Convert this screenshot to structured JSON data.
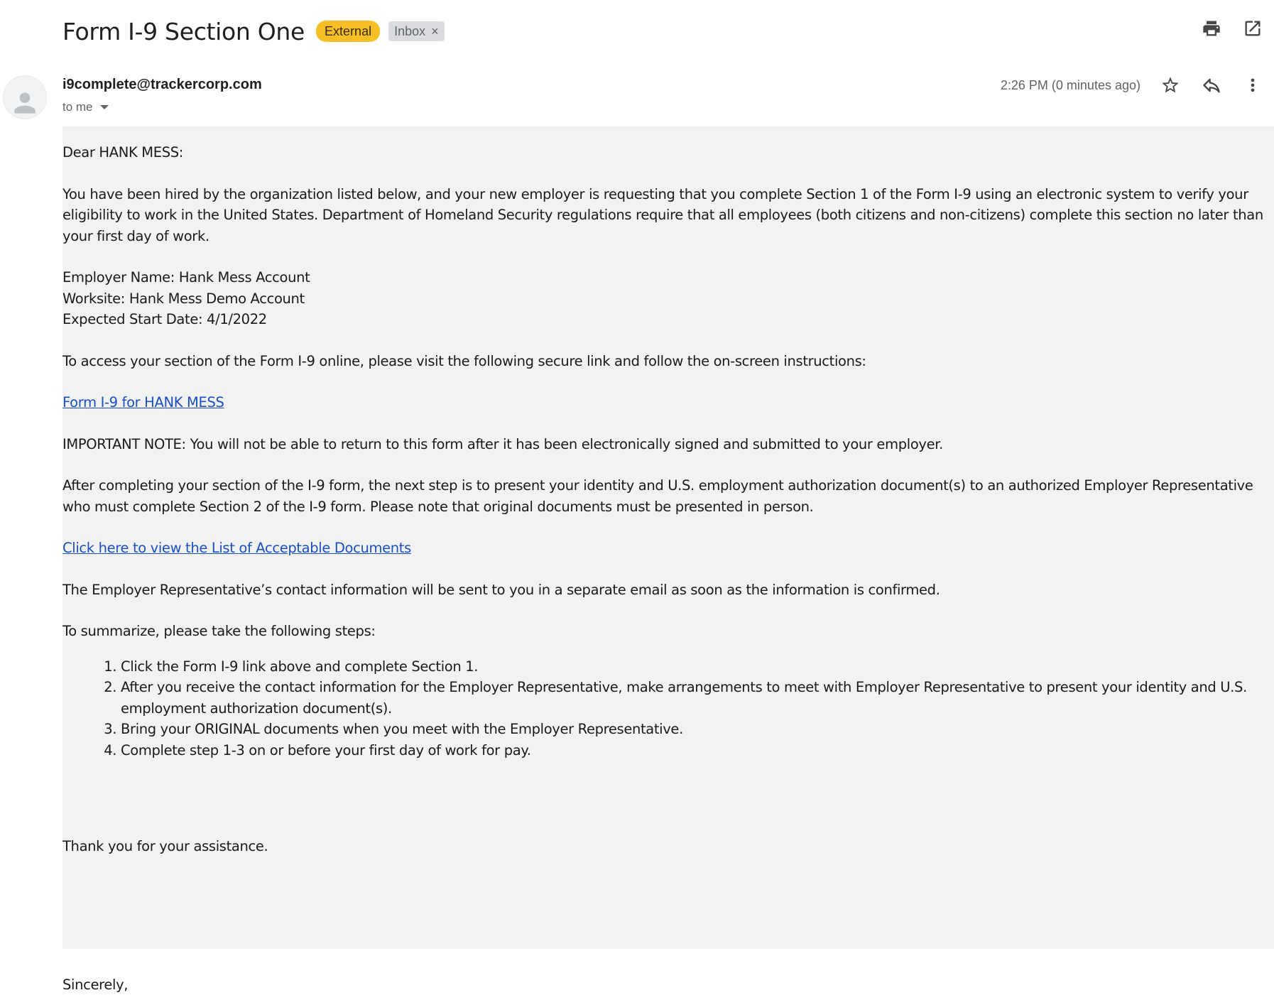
{
  "header": {
    "subject": "Form I-9 Section One",
    "label_external": "External",
    "label_inbox": "Inbox",
    "label_remove": "×"
  },
  "message": {
    "sender": "i9complete@trackercorp.com",
    "recipient": "to me",
    "timestamp": "2:26 PM (0 minutes ago)"
  },
  "body": {
    "greeting": "Dear HANK MESS:",
    "intro": "You have been hired by the organization listed below, and your new employer is requesting that you complete Section 1 of the Form I-9 using an electronic system to verify your eligibility to work in the United States. Department of Homeland Security regulations require that all employees (both citizens and non-citizens) complete this section no later than your first day of work.",
    "employer_name": "Employer Name: Hank Mess Account",
    "worksite": "Worksite: Hank Mess Demo Account",
    "start_date": "Expected Start Date: 4/1/2022",
    "access_text": "To access your section of the Form I-9 online, please visit the following secure link and follow the on-screen instructions:",
    "form_link": "Form I-9 for HANK MESS",
    "important_note": "IMPORTANT NOTE: You will not be able to return to this form after it has been electronically signed and submitted to your employer.",
    "after_completing": "After completing your section of the I-9 form, the next step is to present your identity and U.S. employment authorization document(s) to an authorized Employer Representative who must complete Section 2 of the I-9 form. Please note that original documents must be presented in person.",
    "documents_link": "Click here to view the List of Acceptable Documents",
    "contact_info": "The Employer Representative’s contact information will be sent to you in a separate email as soon as the information is confirmed.",
    "summary_intro": "To summarize, please take the following steps:",
    "steps": [
      "Click the Form I-9 link above and complete Section 1.",
      "After you receive the contact information for the Employer Representative, make arrangements to meet with Employer Representative to present your identity and U.S. employment authorization document(s).",
      "Bring your ORIGINAL documents when you meet with the Employer Representative.",
      "Complete step 1-3 on or before your first day of work for pay."
    ],
    "thanks": "Thank you for your assistance.",
    "signoff": "Sincerely,"
  },
  "icons": {
    "print": "print-icon",
    "open_new_window": "open-in-new-icon",
    "avatar": "person-icon",
    "star": "star-icon",
    "reply": "reply-icon",
    "more": "more-vert-icon"
  }
}
